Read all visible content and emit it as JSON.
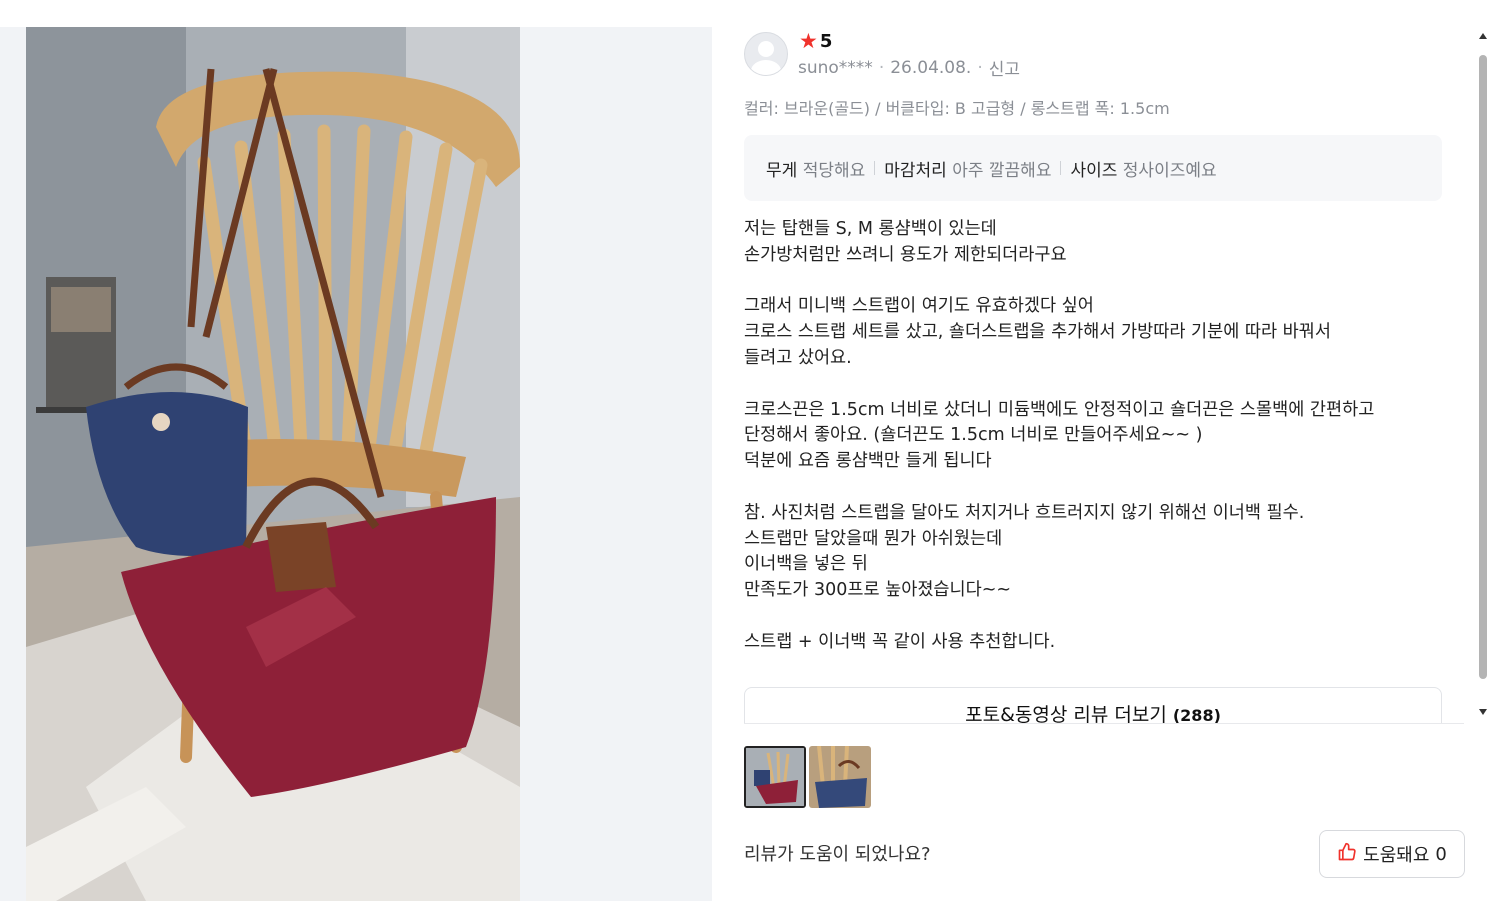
{
  "review": {
    "rating": "5",
    "user": "suno****",
    "date": "26.04.08.",
    "report_label": "신고",
    "options": "컬러: 브라운(골드) / 버클타입: B 고급형 / 롱스트랩 폭: 1.5cm",
    "evaluations": [
      {
        "key": "무게",
        "value": "적당해요"
      },
      {
        "key": "마감처리",
        "value": "아주 깔끔해요"
      },
      {
        "key": "사이즈",
        "value": "정사이즈예요"
      }
    ],
    "body": [
      "저는 탑핸들 S, M 롱샴백이 있는데",
      "손가방처럼만 쓰려니 용도가 제한되더라구요",
      "",
      "그래서 미니백 스트랩이 여기도 유효하겠다 싶어",
      "크로스 스트랩 세트를 샀고, 숄더스트랩을 추가해서 가방따라 기분에 따라 바꿔서",
      "들려고 샀어요.",
      "",
      "크로스끈은 1.5cm 너비로 샀더니 미듐백에도 안정적이고 숄더끈은 스몰백에 간편하고",
      "단정해서 좋아요. (숄더끈도 1.5cm 너비로 만들어주세요~~ )",
      "덕분에 요즘 롱샴백만 들게 됩니다",
      "",
      "참. 사진처럼 스트랩을 달아도 처지거나 흐트러지지 않기 위해선 이너백 필수.",
      "스트랩만 달았을때 뭔가 아쉬웠는데",
      "이너백을 넣은 뒤",
      "만족도가 300프로 높아졌습니다~~",
      "",
      "스트랩 + 이너백 꼭 같이 사용 추천합니다."
    ],
    "more_label": "포토&동영상 리뷰 더보기",
    "more_count": "(288)",
    "helpful_question": "리뷰가 도움이 되었나요?",
    "helpful_label": "도움돼요",
    "helpful_count": "0"
  },
  "colors": {
    "star": "#f0322c",
    "bag_red": "#8e2038",
    "bag_navy": "#2f4272",
    "leather": "#6b3a22"
  },
  "icons": [
    "star-icon",
    "avatar-icon",
    "thumbs-up-icon",
    "scroll-up-icon",
    "scroll-down-icon"
  ]
}
